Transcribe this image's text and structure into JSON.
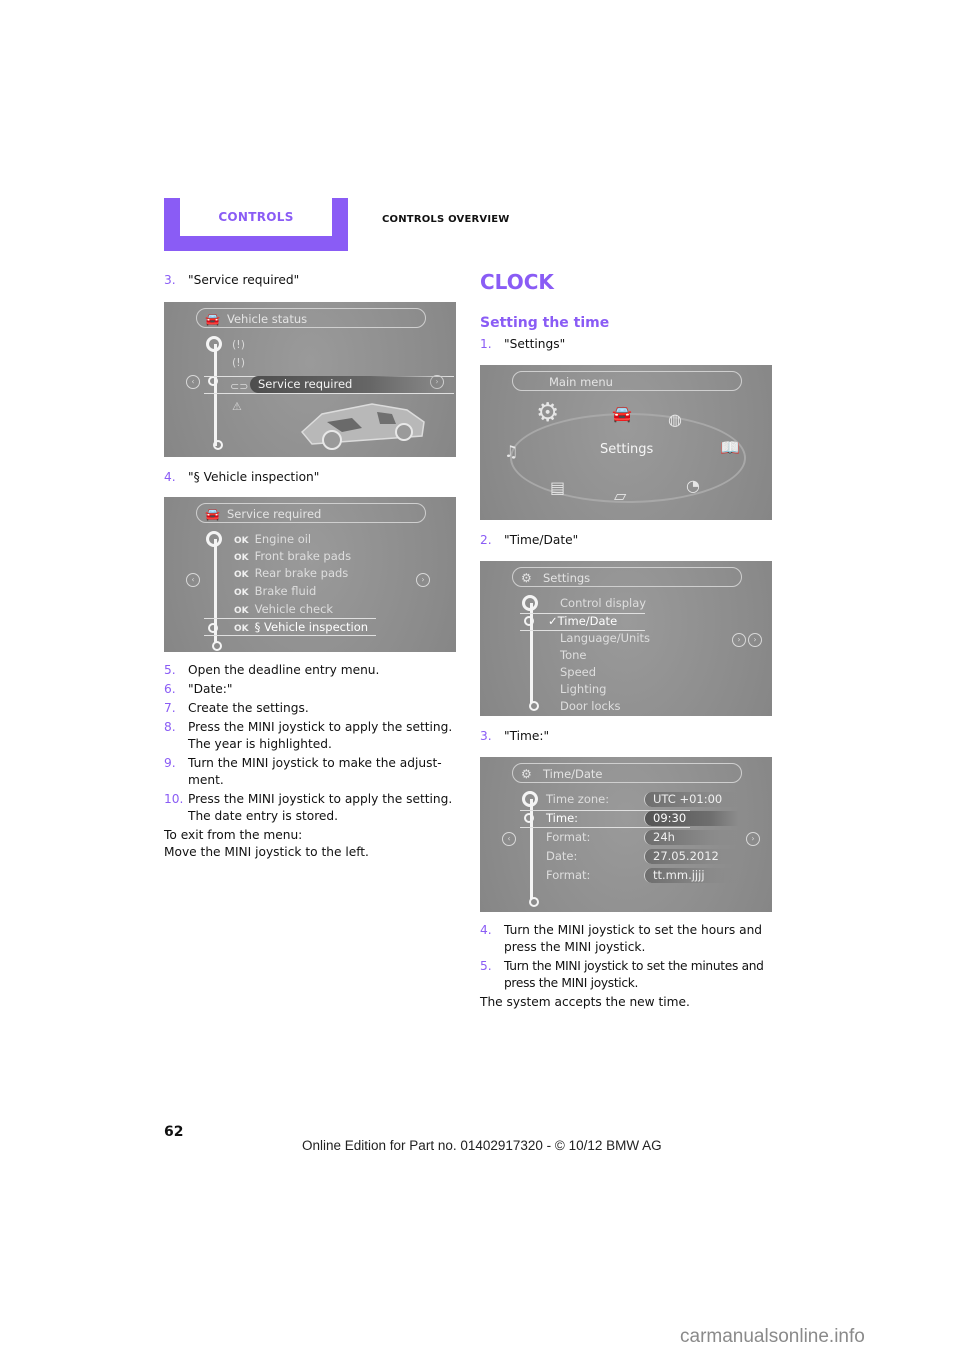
{
  "header": {
    "tab_label": "CONTROLS",
    "section_title": "CONTROLS OVERVIEW"
  },
  "left_column": {
    "step3": {
      "num": "3.",
      "text": "\"Service required\""
    },
    "screen_vehicle_status": {
      "header": "Vehicle status",
      "header_icon": "car-check-icon",
      "items": [
        {
          "icon": "tire-pressure-icon"
        },
        {
          "icon": "tire-warning-icon"
        },
        {
          "icon": "car-service-icon",
          "label": "Service required",
          "selected": true
        },
        {
          "icon": "warning-triangle-icon"
        }
      ]
    },
    "step4": {
      "num": "4.",
      "text": "\"§ Vehicle inspection\""
    },
    "screen_service_required": {
      "header": "Service required",
      "header_icon": "car-check-icon",
      "ok_tag": "OK",
      "items": [
        {
          "label": "Engine oil"
        },
        {
          "label": "Front brake pads"
        },
        {
          "label": "Rear brake pads"
        },
        {
          "label": "Brake fluid"
        },
        {
          "label": "Vehicle check"
        },
        {
          "label": "§ Vehicle inspection",
          "selected": true
        }
      ]
    },
    "steps": [
      {
        "num": "5.",
        "lines": [
          "Open the deadline entry menu."
        ]
      },
      {
        "num": "6.",
        "lines": [
          "\"Date:\""
        ]
      },
      {
        "num": "7.",
        "lines": [
          "Create the settings."
        ]
      },
      {
        "num": "8.",
        "lines": [
          "Press the MINI joystick to apply the setting.",
          "The year is highlighted."
        ]
      },
      {
        "num": "9.",
        "lines": [
          "Turn the MINI joystick to make the adjust-",
          "ment."
        ]
      },
      {
        "num": "10.",
        "lines": [
          "Press the MINI joystick to apply the setting.",
          "The date entry is stored."
        ]
      }
    ],
    "exit_lines": [
      "To exit from the menu:",
      "Move the MINI joystick to the left."
    ]
  },
  "right_column": {
    "heading": "CLOCK",
    "subheading": "Setting the time",
    "step1": {
      "num": "1.",
      "text": "\"Settings\""
    },
    "screen_main_menu": {
      "header": "Main menu",
      "center_label": "Settings",
      "icons": [
        "settings-gear-icon",
        "vehicle-info-icon",
        "navigation-globe-icon",
        "manual-book-icon",
        "trip-computer-icon",
        "phone-icon",
        "radio-icon",
        "media-icon"
      ]
    },
    "step2": {
      "num": "2.",
      "text": "\"Time/Date\""
    },
    "screen_settings": {
      "header": "Settings",
      "header_icon": "gear-icon",
      "items": [
        {
          "label": "Control display"
        },
        {
          "label": "✓Time/Date",
          "selected": true
        },
        {
          "label": "Language/Units"
        },
        {
          "label": "Tone"
        },
        {
          "label": "Speed"
        },
        {
          "label": "Lighting"
        },
        {
          "label": "Door locks"
        }
      ]
    },
    "step3": {
      "num": "3.",
      "text": "\"Time:\""
    },
    "screen_time_date": {
      "header": "Time/Date",
      "header_icon": "gear-icon",
      "rows": [
        {
          "label": "Time zone:",
          "value": "UTC +01:00"
        },
        {
          "label": "Time:",
          "value": "09:30",
          "selected": true
        },
        {
          "label": "Format:",
          "value": "24h"
        },
        {
          "label": "Date:",
          "value": "27.05.2012"
        },
        {
          "label": "Format:",
          "value": "tt.mm.jjjj"
        }
      ]
    },
    "steps": [
      {
        "num": "4.",
        "lines": [
          "Turn the MINI joystick to set the hours and",
          "press the MINI joystick."
        ]
      },
      {
        "num": "5.",
        "lines": [
          "Turn the MINI joystick to set the minutes and",
          "press the MINI joystick."
        ]
      }
    ],
    "closing": "The system accepts the new time."
  },
  "footer": {
    "page_number": "62",
    "edition": "Online Edition for Part no. 01402917320 - © 10/12 BMW AG",
    "watermark": "carmanualsonline.info"
  },
  "colors": {
    "accent": "#8a5cf5",
    "screen_gray": "#8b8b8b"
  }
}
